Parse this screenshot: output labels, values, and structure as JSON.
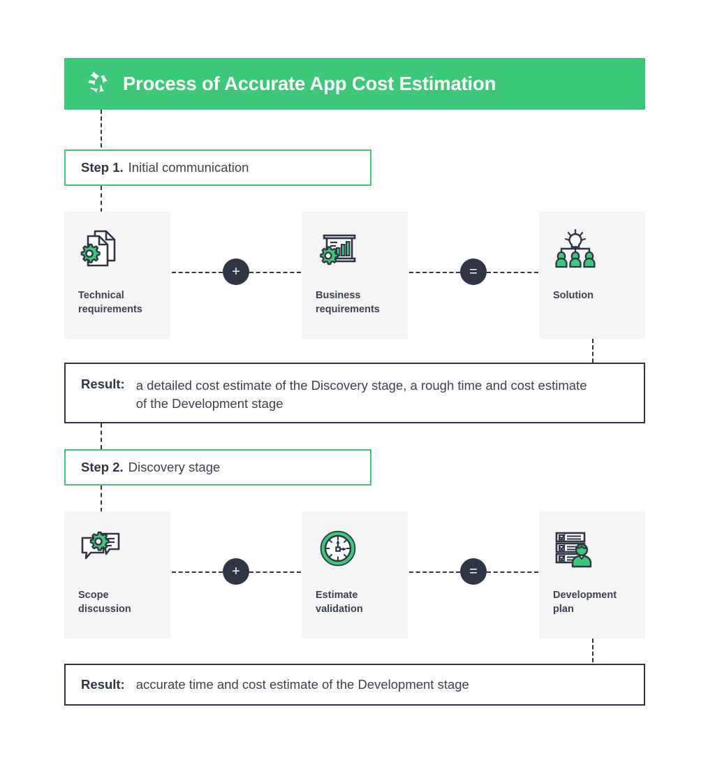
{
  "header": {
    "title": "Process of Accurate App Cost Estimation",
    "logo_icon": "abstract-star-logo-icon",
    "background_color": "#3cc878",
    "text_color": "#ffffff"
  },
  "theme": {
    "green": "#3cc878",
    "dark": "#2f3545",
    "card_background": "#f5f5f5",
    "page_background": "#ffffff"
  },
  "steps": [
    {
      "number": "Step 1.",
      "label": "Initial communication",
      "cards": [
        {
          "icon": "documents-gear-icon",
          "label": "Technical\nrequirements"
        },
        {
          "icon": "presentation-chart-gear-icon",
          "label": "Business\nrequirements"
        },
        {
          "icon": "team-lightbulb-icon",
          "label": "Solution"
        }
      ],
      "operators": [
        {
          "name": "plus-operator",
          "symbol": "+"
        },
        {
          "name": "equals-operator",
          "symbol": "="
        }
      ],
      "result": {
        "label": "Result:",
        "text": "a detailed cost estimate of the Discovery stage, a rough time and cost estimate of the Development stage"
      }
    },
    {
      "number": "Step 2.",
      "label": "Discovery stage",
      "cards": [
        {
          "icon": "speech-bubbles-gear-icon",
          "label": "Scope\ndiscussion"
        },
        {
          "icon": "clock-icon",
          "label": "Estimate\nvalidation"
        },
        {
          "icon": "checklist-person-icon",
          "label": "Development\nplan"
        }
      ],
      "operators": [
        {
          "name": "plus-operator",
          "symbol": "+"
        },
        {
          "name": "equals-operator",
          "symbol": "="
        }
      ],
      "result": {
        "label": "Result:",
        "text": "accurate time and cost estimate of the Development stage"
      }
    }
  ]
}
